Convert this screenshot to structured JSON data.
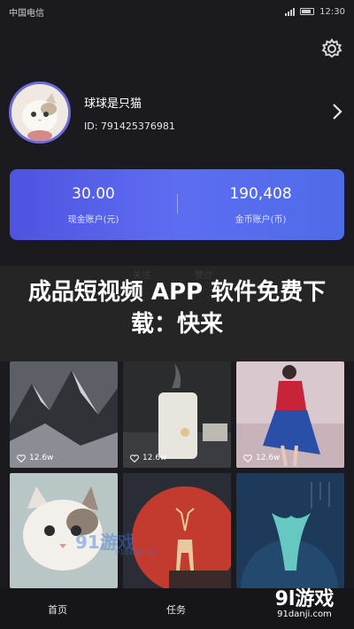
{
  "status_bar": {
    "carrier": "中国电信",
    "time": "12:30"
  },
  "icons": {
    "settings": "gear-icon",
    "chevron": "chevron-right-icon",
    "heart": "heart-icon"
  },
  "profile": {
    "name": "球球是只猫",
    "id_text": "ID: 791425376981"
  },
  "wallet": {
    "cash": {
      "value": "30.00",
      "label": "现金账户(元)"
    },
    "coins": {
      "value": "190,408",
      "label": "金币账户(币)"
    }
  },
  "tabs": [
    {
      "label": "关注"
    },
    {
      "label": "赞过"
    }
  ],
  "overlay": {
    "headline": "成品短视频 APP 软件免费下载：快来"
  },
  "videos": [
    {
      "likes": "12.6w"
    },
    {
      "likes": "12.6w"
    },
    {
      "likes": "12.6w"
    }
  ],
  "watermarks": {
    "mid_logo": "91游戏",
    "mid_url": "91danji.com",
    "corner_logo": "9l游戏",
    "corner_url": "91danji.com"
  },
  "bottom_nav": [
    {
      "label": "首页"
    },
    {
      "label": "任务"
    }
  ],
  "colors": {
    "accent": "#5a63ea",
    "background": "#1b1b1f"
  }
}
